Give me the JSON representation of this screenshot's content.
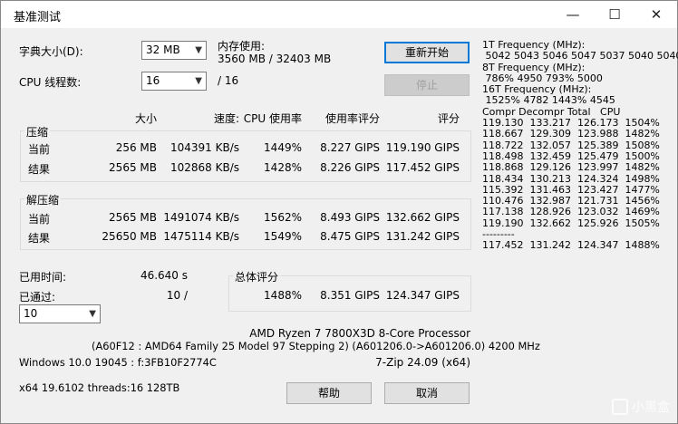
{
  "window": {
    "title": "基准测试"
  },
  "dict": {
    "label": "字典大小(D):",
    "value": "32 MB"
  },
  "threads": {
    "label": "CPU 线程数:",
    "value": "16",
    "total": "/ 16"
  },
  "memory": {
    "label": "内存使用:",
    "value": "3560 MB / 32403 MB"
  },
  "buttons": {
    "restart": "重新开始",
    "stop": "停止",
    "help": "帮助",
    "cancel": "取消"
  },
  "headers": {
    "size": "大小",
    "speed": "速度:",
    "cpu": "CPU 使用率",
    "rating_per_usage": "使用率评分",
    "rating": "评分"
  },
  "compress": {
    "title": "压缩",
    "rows": [
      {
        "label": "当前",
        "size": "256 MB",
        "speed": "104391 KB/s",
        "cpu": "1449%",
        "rpu": "8.227 GIPS",
        "rating": "119.190 GIPS"
      },
      {
        "label": "结果",
        "size": "2565 MB",
        "speed": "102868 KB/s",
        "cpu": "1428%",
        "rpu": "8.226 GIPS",
        "rating": "117.452 GIPS"
      }
    ]
  },
  "decompress": {
    "title": "解压缩",
    "rows": [
      {
        "label": "当前",
        "size": "2565 MB",
        "speed": "1491074 KB/s",
        "cpu": "1562%",
        "rpu": "8.493 GIPS",
        "rating": "132.662 GIPS"
      },
      {
        "label": "结果",
        "size": "25650 MB",
        "speed": "1475114 KB/s",
        "cpu": "1549%",
        "rpu": "8.475 GIPS",
        "rating": "131.242 GIPS"
      }
    ]
  },
  "elapsed": {
    "label": "已用时间:",
    "value": "46.640 s"
  },
  "passes": {
    "label": "已通过:",
    "value": "10 /",
    "select": "10"
  },
  "total": {
    "title": "总体评分",
    "cpu": "1488%",
    "rpu": "8.351 GIPS",
    "rating": "124.347 GIPS"
  },
  "cpu_info": {
    "line1": "AMD Ryzen 7 7800X3D 8-Core Processor",
    "line2": "(A60F12 : AMD64 Family 25 Model 97 Stepping 2) (A601206.0->A601206.0) 4200 MHz"
  },
  "sys_info": {
    "os": "Windows 10.0 19045 : f:3FB10F2774C",
    "version": "7-Zip 24.09 (x64)",
    "extra": "x64 19.6102 threads:16 128TB"
  },
  "side_lines": [
    "1T Frequency (MHz):",
    " 5042 5043 5046 5047 5037 5040 5040",
    "8T Frequency (MHz):",
    " 786% 4950 793% 5000",
    "16T Frequency (MHz):",
    " 1525% 4782 1443% 4545",
    "Compr Decompr Total   CPU",
    "119.130  133.217  126.173  1504%",
    "118.667  129.309  123.988  1482%",
    "118.722  132.057  125.389  1508%",
    "118.498  132.459  125.479  1500%",
    "118.868  129.126  123.997  1482%",
    "118.434  130.213  124.324  1498%",
    "115.392  131.463  123.427  1477%",
    "110.476  132.987  121.731  1456%",
    "117.138  128.926  123.032  1469%",
    "119.190  132.662  125.926  1505%",
    "---------",
    "117.452  131.242  124.347  1488%"
  ],
  "watermark": "小黑盒"
}
